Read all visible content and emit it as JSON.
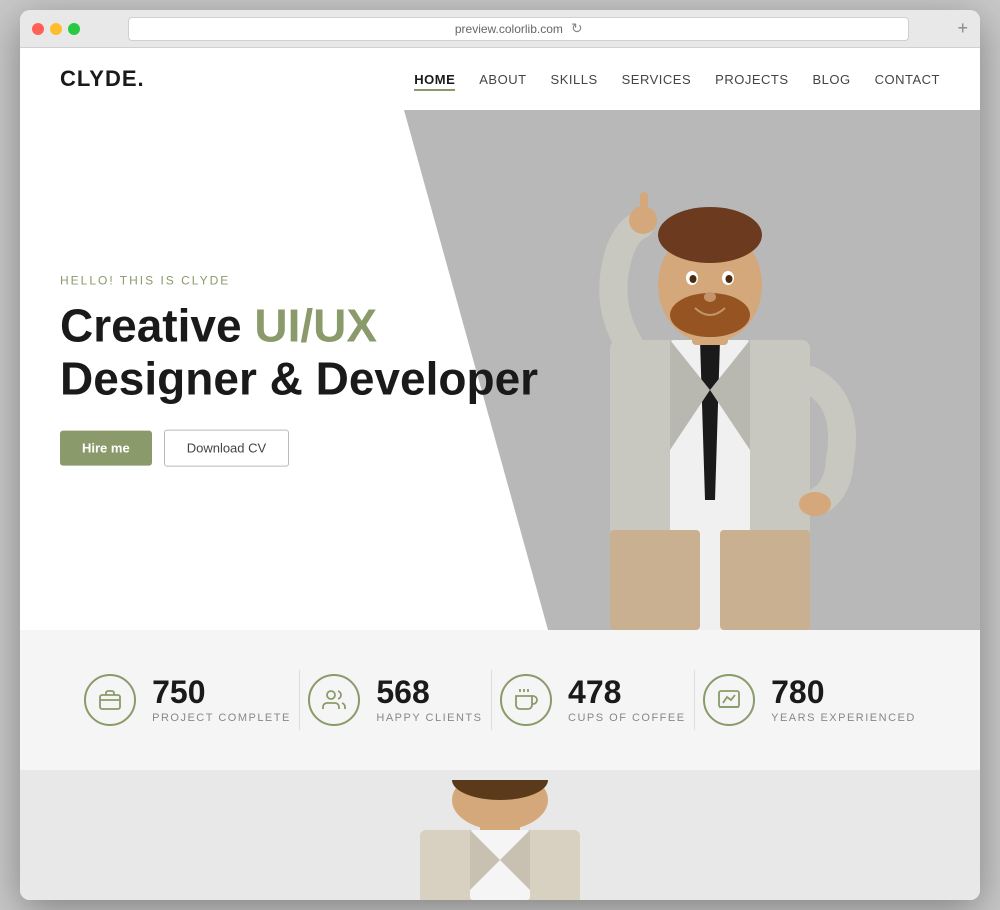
{
  "browser": {
    "url": "preview.colorlib.com",
    "dots": [
      "red",
      "yellow",
      "green"
    ]
  },
  "site": {
    "logo": "CLYDE.",
    "nav": [
      {
        "label": "HOME",
        "active": true
      },
      {
        "label": "ABOUT",
        "active": false
      },
      {
        "label": "SKILLS",
        "active": false
      },
      {
        "label": "SERVICES",
        "active": false
      },
      {
        "label": "PROJECTS",
        "active": false
      },
      {
        "label": "BLOG",
        "active": false
      },
      {
        "label": "CONTACT",
        "active": false
      }
    ]
  },
  "hero": {
    "greeting": "HELLO! THIS IS CLYDE",
    "title_line1": "Creative UI/UX",
    "title_line2": "Designer & Developer",
    "title_highlight": "UI/UX",
    "btn_hire": "Hire me",
    "btn_cv": "Download CV"
  },
  "stats": [
    {
      "number": "750",
      "label": "PROJECT COMPLETE",
      "icon": "briefcase"
    },
    {
      "number": "568",
      "label": "HAPPY CLIENTS",
      "icon": "users"
    },
    {
      "number": "478",
      "label": "CUPS OF COFFEE",
      "icon": "coffee"
    },
    {
      "number": "780",
      "label": "YEARS EXPERIENCED",
      "icon": "chart"
    }
  ],
  "colors": {
    "accent": "#8a9a6a",
    "dark": "#1a1a1a",
    "light_bg": "#f5f5f5"
  }
}
